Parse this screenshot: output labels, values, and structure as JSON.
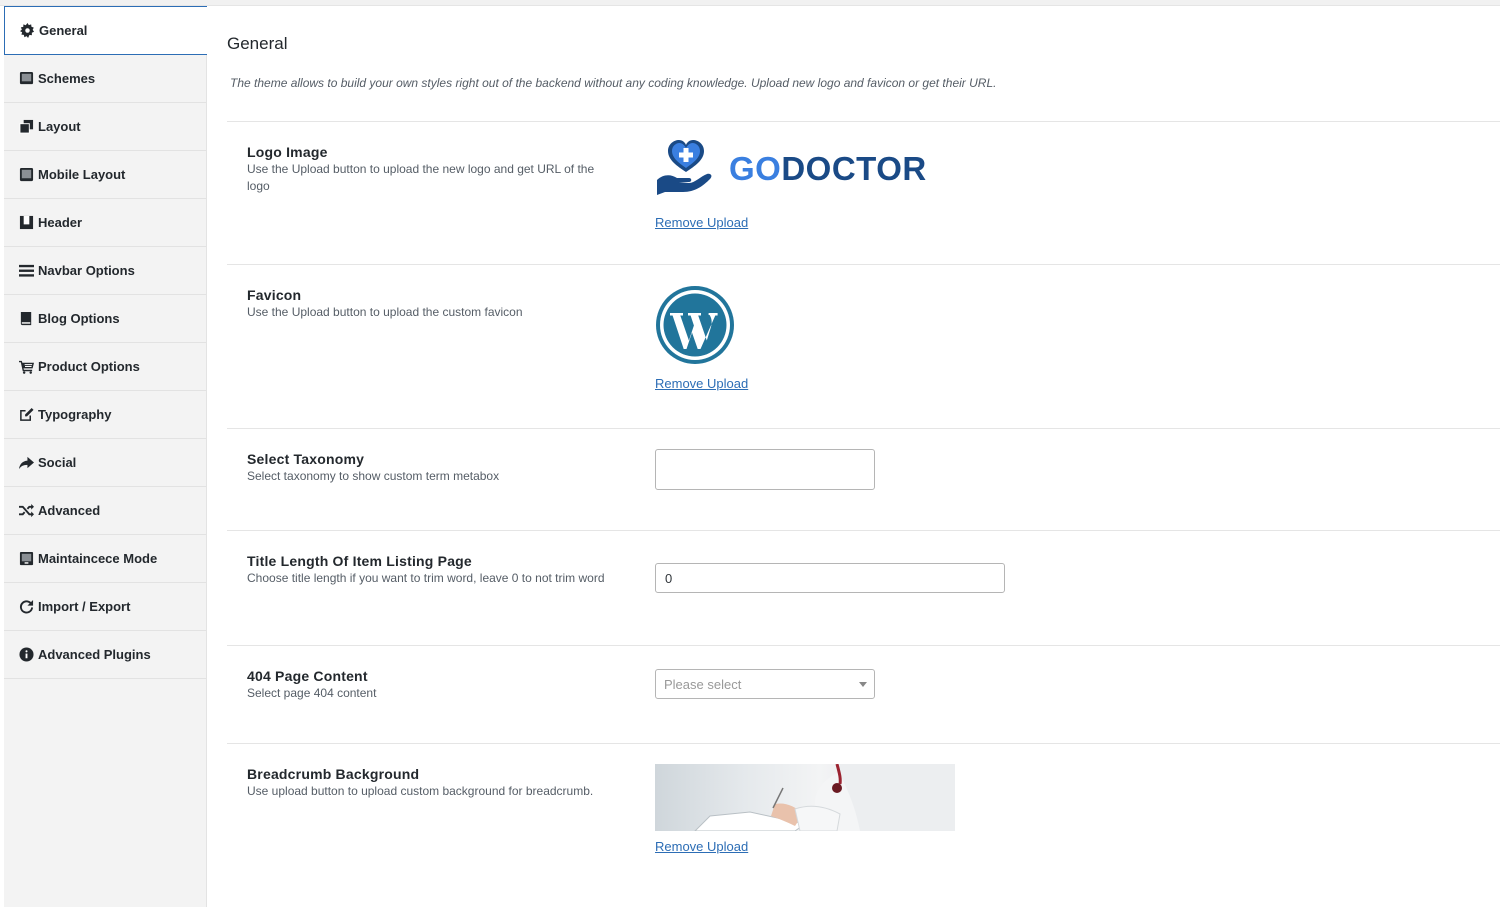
{
  "sidebar": {
    "items": [
      {
        "label": "General",
        "icon": "gear-icon"
      },
      {
        "label": "Schemes",
        "icon": "monitor-icon"
      },
      {
        "label": "Layout",
        "icon": "copy-icon"
      },
      {
        "label": "Mobile Layout",
        "icon": "tablet-icon"
      },
      {
        "label": "Header",
        "icon": "header-icon"
      },
      {
        "label": "Navbar Options",
        "icon": "bars-icon"
      },
      {
        "label": "Blog Options",
        "icon": "book-icon"
      },
      {
        "label": "Product Options",
        "icon": "cart-icon"
      },
      {
        "label": "Typography",
        "icon": "edit-icon"
      },
      {
        "label": "Social",
        "icon": "share-icon"
      },
      {
        "label": "Advanced",
        "icon": "shuffle-icon"
      },
      {
        "label": "Maintaincece Mode",
        "icon": "maintenance-icon"
      },
      {
        "label": "Import / Export",
        "icon": "refresh-icon"
      },
      {
        "label": "Advanced Plugins",
        "icon": "info-icon"
      }
    ]
  },
  "main": {
    "title": "General",
    "description": "The theme allows to build your own styles right out of the backend without any coding knowledge. Upload new logo and favicon or get their URL.",
    "logo": {
      "label": "Logo Image",
      "help": "Use the Upload button to upload the new logo and get URL of the logo",
      "logo_text_go": "GO",
      "logo_text_doctor": "DOCTOR",
      "remove": "Remove Upload"
    },
    "favicon": {
      "label": "Favicon",
      "help": "Use the Upload button to upload the custom favicon",
      "remove": "Remove Upload"
    },
    "taxonomy": {
      "label": "Select Taxonomy",
      "help": "Select taxonomy to show custom term metabox",
      "value": ""
    },
    "title_length": {
      "label": "Title Length Of Item Listing Page",
      "help": "Choose title length if you want to trim word, leave 0 to not trim word",
      "value": "0"
    },
    "page404": {
      "label": "404 Page Content",
      "help": "Select page 404 content",
      "placeholder": "Please select"
    },
    "breadcrumb": {
      "label": "Breadcrumb Background",
      "help": "Use upload button to upload custom background for breadcrumb.",
      "remove": "Remove Upload"
    }
  },
  "colors": {
    "accent": "#2c6db5",
    "logo_go": "#3a7fe0",
    "logo_doctor": "#1a4a86",
    "wordpress_blue": "#21759b"
  }
}
